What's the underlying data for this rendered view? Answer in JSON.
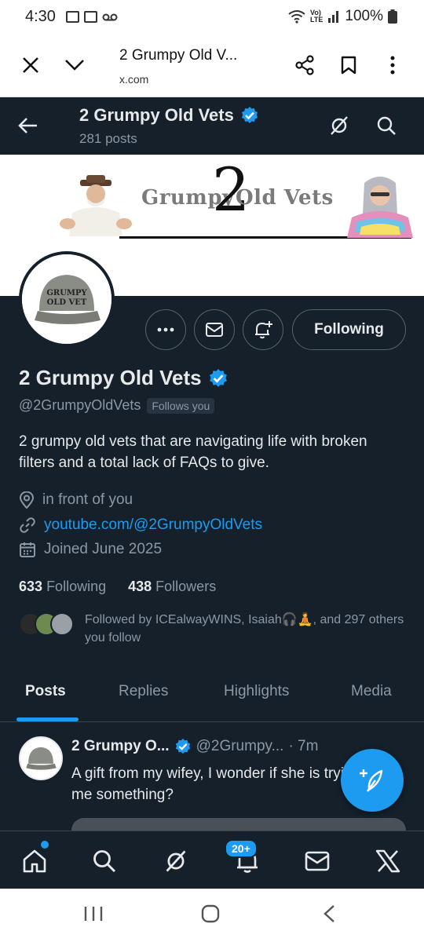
{
  "status_bar": {
    "time": "4:30",
    "battery": "100%"
  },
  "browser": {
    "page_title": "2 Grumpy Old V...",
    "url": "x.com"
  },
  "header": {
    "name": "2 Grumpy Old Vets",
    "post_count": "281 posts"
  },
  "banner": {
    "text_left": "Grumpy",
    "text_num": "2",
    "text_right": "Old Vets"
  },
  "avatar": {
    "cap_line1": "GRUMPY",
    "cap_line2": "OLD VET"
  },
  "actions": {
    "following_label": "Following"
  },
  "profile": {
    "name": "2 Grumpy Old Vets",
    "handle": "@2GrumpyOldVets",
    "follows_you": "Follows you",
    "bio": "2 grumpy old vets that are navigating life with broken filters and a total lack of FAQs to give.",
    "location": "in front of you",
    "website": "youtube.com/@2GrumpyOldVets",
    "joined": "Joined June 2025",
    "following_count": "633",
    "following_label": "Following",
    "followers_count": "438",
    "followers_label": "Followers",
    "followed_by": "Followed by ICEalwayWINS, Isaiah🎧🧘, and 297 others you follow"
  },
  "tabs": [
    {
      "label": "Posts",
      "active": true
    },
    {
      "label": "Replies",
      "active": false
    },
    {
      "label": "Highlights",
      "active": false
    },
    {
      "label": "Media",
      "active": false
    }
  ],
  "post": {
    "name": "2 Grumpy O...",
    "handle": "@2Grumpy...",
    "time": "· 7m",
    "text": "A gift from my wifey, I wonder if she is trying to tell me something?"
  },
  "bottom_nav": {
    "notifications_badge": "20+"
  },
  "colors": {
    "background": "#15202b",
    "accent": "#1d9bf0",
    "text_primary": "#e7e9ea",
    "text_secondary": "#8b98a5",
    "border": "#38444d"
  },
  "icons": {
    "verified": "verified-badge-icon",
    "location": "location-pin-icon",
    "link": "link-icon",
    "calendar": "calendar-icon"
  }
}
